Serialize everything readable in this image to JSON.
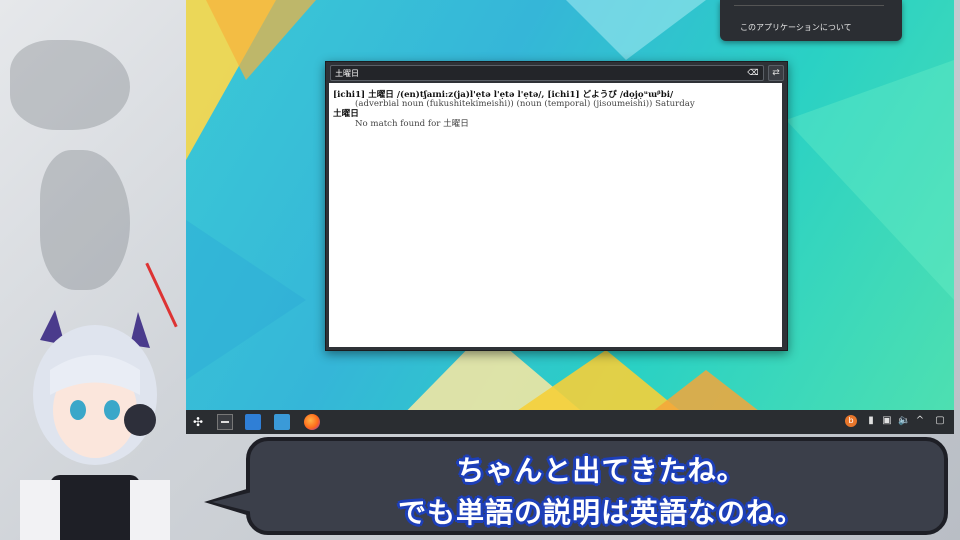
{
  "search": {
    "value": "土曜日"
  },
  "menu": {
    "item_about": "このアプリケーションについて"
  },
  "result": {
    "line1": "[ichi1] 土曜日 /(en)tʃaɪni:z(ja)l'ẹtə l'ẹtə l'ẹtə/, [ichi1] どようび /dọjọᵘɯᵝbi/",
    "line2": "(adverbial noun (fukushitekimeishi)) (noun (temporal) (jisoumeishi)) Saturday",
    "line3": "土曜日",
    "line4": "No match found for 土曜日"
  },
  "taskbar": {
    "icons": [
      "launcher-icon",
      "terminal-icon",
      "files-icon",
      "folder-icon",
      "firefox-icon"
    ],
    "tray": [
      "update-icon",
      "usb-icon",
      "clipboard-icon",
      "volume-icon",
      "chevron-up-icon",
      "show-desktop-icon"
    ]
  },
  "subtitle": {
    "line1": "ちゃんと出てきたね。",
    "line2": "でも単語の説明は英語なのね。"
  },
  "colors": {
    "subtitle_outline": "#1d3fb8",
    "bubble_fill": "#3b3f4a",
    "taskbar": "#2a2d31"
  }
}
